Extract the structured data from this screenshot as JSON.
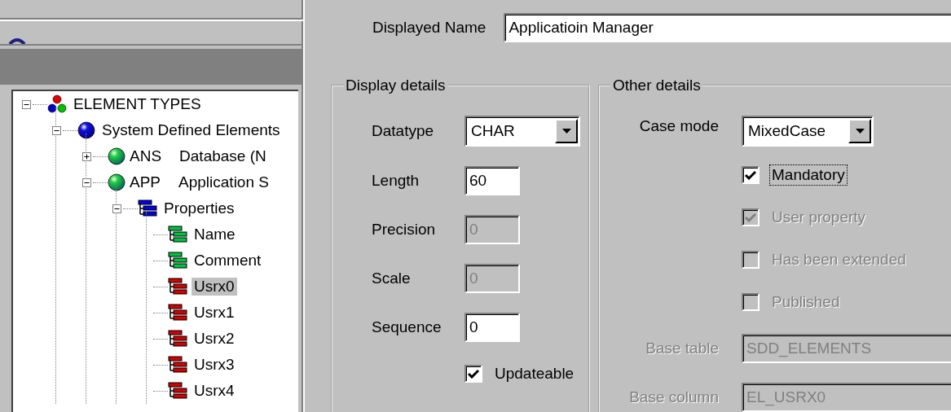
{
  "tree": [
    {
      "label": "ELEMENT TYPES",
      "kind": "root",
      "expanded": true,
      "selected": false,
      "children": [
        {
          "label": "System Defined Elements",
          "kind": "system",
          "expanded": true,
          "selected": false,
          "children": [
            {
              "code": "ANS",
              "label": "Database (N",
              "kind": "element",
              "expanded": false,
              "selected": false
            },
            {
              "code": "APP",
              "label": "Application S",
              "kind": "element",
              "expanded": true,
              "selected": false,
              "children": [
                {
                  "label": "Properties",
                  "kind": "properties",
                  "expanded": true,
                  "selected": false,
                  "children": [
                    {
                      "label": "Name",
                      "kind": "property-green",
                      "selected": false
                    },
                    {
                      "label": "Comment",
                      "kind": "property-green",
                      "selected": false
                    },
                    {
                      "label": "Usrx0",
                      "kind": "property-red",
                      "selected": true
                    },
                    {
                      "label": "Usrx1",
                      "kind": "property-red",
                      "selected": false
                    },
                    {
                      "label": "Usrx2",
                      "kind": "property-red",
                      "selected": false
                    },
                    {
                      "label": "Usrx3",
                      "kind": "property-red",
                      "selected": false
                    },
                    {
                      "label": "Usrx4",
                      "kind": "property-red",
                      "selected": false
                    }
                  ]
                }
              ]
            }
          ]
        }
      ]
    }
  ],
  "displayed_name": {
    "label": "Displayed Name",
    "value": "Applicatioin Manager"
  },
  "display_details": {
    "title": "Display details",
    "fields": [
      {
        "kind": "combo",
        "label": "Datatype",
        "value": "CHAR",
        "disabled": false
      },
      {
        "kind": "input",
        "label": "Length",
        "value": "60",
        "disabled": false
      },
      {
        "kind": "input",
        "label": "Precision",
        "value": "0",
        "disabled": true
      },
      {
        "kind": "input",
        "label": "Scale",
        "value": "0",
        "disabled": true
      },
      {
        "kind": "input",
        "label": "Sequence",
        "value": "0",
        "disabled": false
      }
    ],
    "checkboxes": [
      {
        "label": "Updateable",
        "checked": true,
        "disabled": false,
        "focused": false
      }
    ]
  },
  "other_details": {
    "title": "Other details",
    "case_mode": {
      "label": "Case mode",
      "value": "MixedCase"
    },
    "checkboxes": [
      {
        "label": "Mandatory",
        "checked": true,
        "disabled": false,
        "focused": true
      },
      {
        "label": "User property",
        "checked": true,
        "disabled": true,
        "focused": false
      },
      {
        "label": "Has been extended",
        "checked": false,
        "disabled": true,
        "focused": false
      },
      {
        "label": "Published",
        "checked": false,
        "disabled": true,
        "focused": false
      }
    ],
    "fields": [
      {
        "label": "Base table",
        "value": "SDD_ELEMENTS",
        "disabled": true
      },
      {
        "label": "Base column",
        "value": "EL_USRX0",
        "disabled": true
      }
    ]
  }
}
